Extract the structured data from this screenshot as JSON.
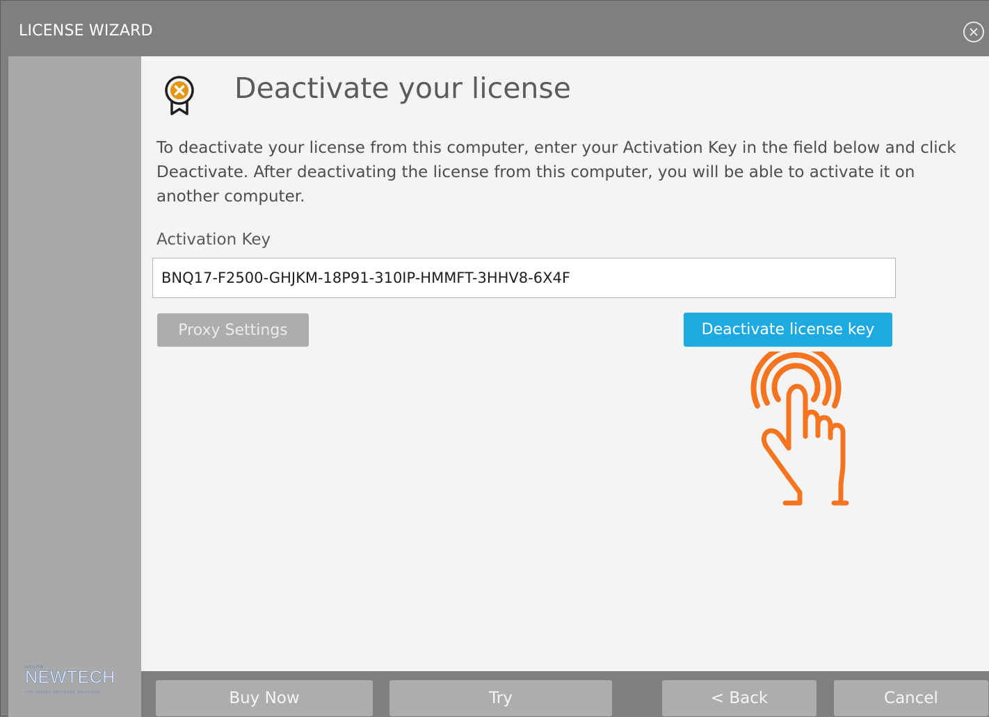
{
  "window": {
    "title": "LICENSE WIZARD"
  },
  "sidebar": {
    "logo": {
      "sub": "BRUHN",
      "brand": "NEWTECH",
      "tagline": "LIFE SAVING SOFTWARE SOLUTIONS"
    }
  },
  "main": {
    "heading": "Deactivate your license",
    "description": "To deactivate your license from this computer, enter your Activation Key in the field below and click Deactivate. After deactivating the license from this computer, you will be able to activate it on another computer.",
    "key_label": "Activation Key",
    "key_value": "BNQ17-F2500-GHJKM-18P91-310IP-HMMFT-3HHV8-6X4F",
    "proxy_button": "Proxy Settings",
    "deactivate_button": "Deactivate license key"
  },
  "footer": {
    "buy_now": "Buy Now",
    "try": "Try",
    "back": "< Back",
    "cancel": "Cancel"
  },
  "icons": {
    "close": "close-circle-icon",
    "header": "license-ribbon-x-icon",
    "hand": "tap-hand-icon"
  },
  "colors": {
    "accent": "#1fa9e1",
    "icon_orange": "#e59510",
    "hand_orange": "#f57420",
    "titlebar": "#7f7f7f",
    "content_bg": "#f4f4f4",
    "sidebar": "#a9a9a9"
  }
}
